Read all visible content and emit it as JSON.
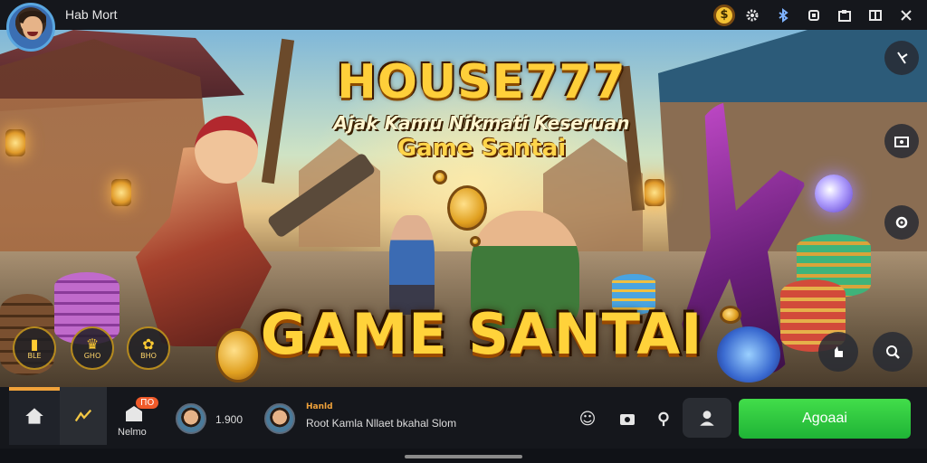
{
  "window": {
    "title": "Hab Mort"
  },
  "topbar": {
    "icons": [
      "coin-icon",
      "info-icon",
      "settings-icon",
      "bluetooth-icon",
      "copy-icon",
      "screenshot-icon",
      "split-icon",
      "close-icon"
    ],
    "coin_glyph": "$"
  },
  "banner": {
    "title": "HOUSE777",
    "subtitle": "Ajak Kamu Nikmati Keseruan",
    "tagline": "Game Santai",
    "headline": "GAME SANTAI",
    "round_buttons": [
      {
        "label": "BLE",
        "icon": "box-icon"
      },
      {
        "label": "GHO",
        "icon": "trophy-icon"
      },
      {
        "label": "BHO",
        "icon": "gift-icon"
      }
    ],
    "side_buttons": [
      "compass-icon",
      "camera-icon",
      "search-icon",
      "hand-icon",
      "zoom-icon"
    ]
  },
  "bottombar": {
    "notif_badge": "ПО",
    "notif_label": "Nelmo",
    "count": "1.900",
    "chat_name": "Hanld",
    "chat_message": "Root Kamla  Nllaet bkahal Slom",
    "action_label": "Agoaai"
  }
}
